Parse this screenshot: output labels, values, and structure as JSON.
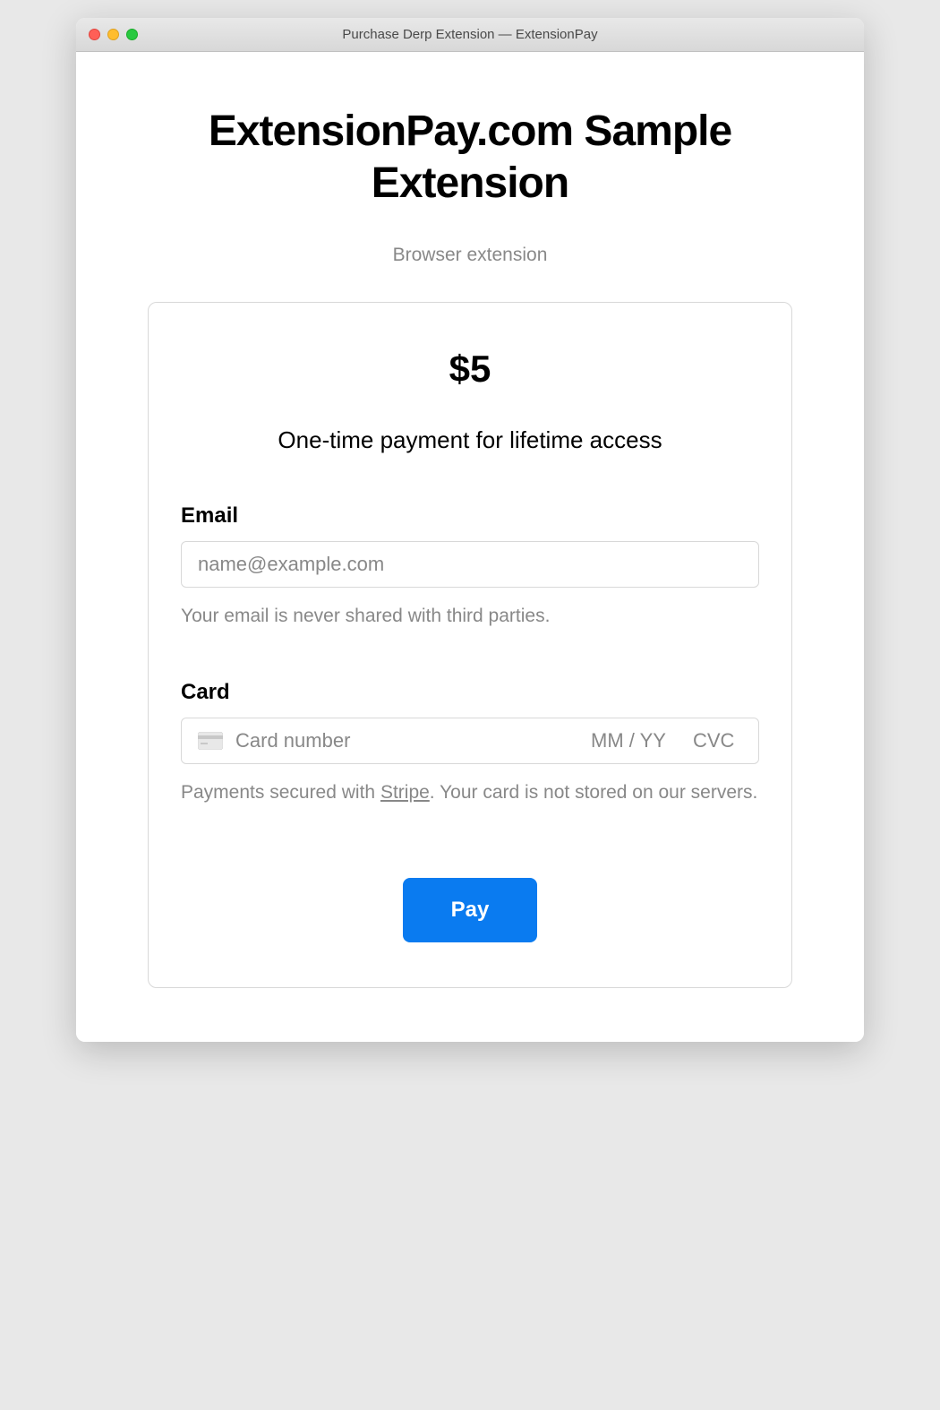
{
  "window": {
    "title": "Purchase Derp Extension — ExtensionPay"
  },
  "header": {
    "title": "ExtensionPay.com Sample Extension",
    "subtitle": "Browser extension"
  },
  "payment": {
    "price": "$5",
    "description": "One-time payment for lifetime access",
    "email": {
      "label": "Email",
      "placeholder": "name@example.com",
      "value": "",
      "help_text": "Your email is never shared with third parties."
    },
    "card": {
      "label": "Card",
      "number_placeholder": "Card number",
      "exp_placeholder": "MM / YY",
      "cvc_placeholder": "CVC",
      "help_text_prefix": "Payments secured with ",
      "help_link_text": "Stripe",
      "help_text_suffix": ". Your card is not stored on our servers."
    },
    "submit_label": "Pay"
  }
}
